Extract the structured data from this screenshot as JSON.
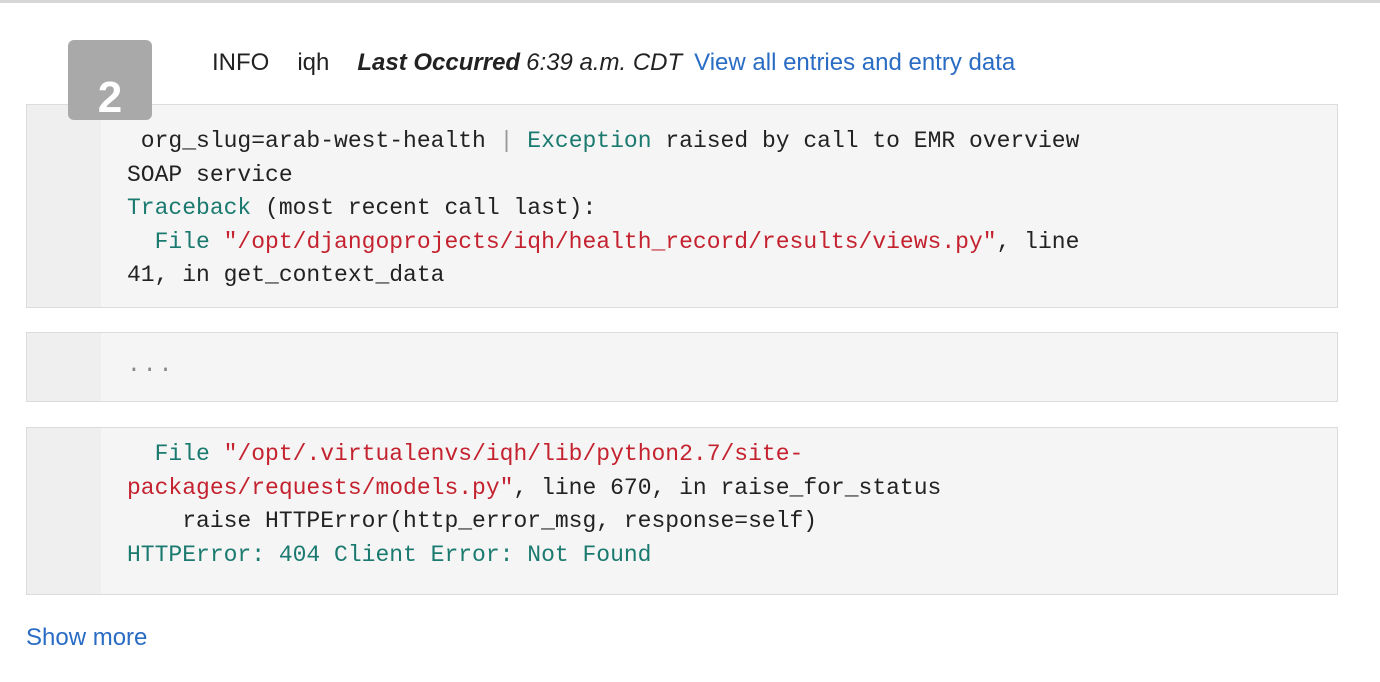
{
  "entry": {
    "number": "2",
    "level": "INFO",
    "app": "iqh",
    "last_occurred_label": "Last Occurred",
    "last_occurred_time": "6:39 a.m. CDT",
    "view_all_link": "View all entries and entry data"
  },
  "blocks": {
    "first": {
      "l1_a": " org_slug=arab-west-health ",
      "l1_pipe": "|",
      "l1_b": " ",
      "l1_exc": "Exception",
      "l1_c": " raised by call to EMR overview",
      "l2": "SOAP service",
      "l3_exc": "Traceback",
      "l3_rest": " (most recent call last):",
      "l4_a": "  File ",
      "l4_str": "\"/opt/djangoprojects/iqh/health_record/results/views.py\"",
      "l4_b": ", line",
      "l5": "41, in get_context_data"
    },
    "ellipsis": "...",
    "last": {
      "l1_a": "  File ",
      "l1_str": "\"/opt/.virtualenvs/iqh/lib/python2.7/site-",
      "l2_str": "packages/requests/models.py\"",
      "l2_b": ", line 670, in raise_for_status",
      "l3": "    raise HTTPError(http_error_msg, response=self)",
      "l4_exc": "HTTPError: 404 Client Error: Not Found"
    }
  },
  "footer": {
    "show_more": "Show more"
  },
  "colors": {
    "link": "#2a6cc4",
    "badge": "#a9a9a9",
    "exception_token": "#1a7a6f",
    "string_token": "#c4222f"
  }
}
